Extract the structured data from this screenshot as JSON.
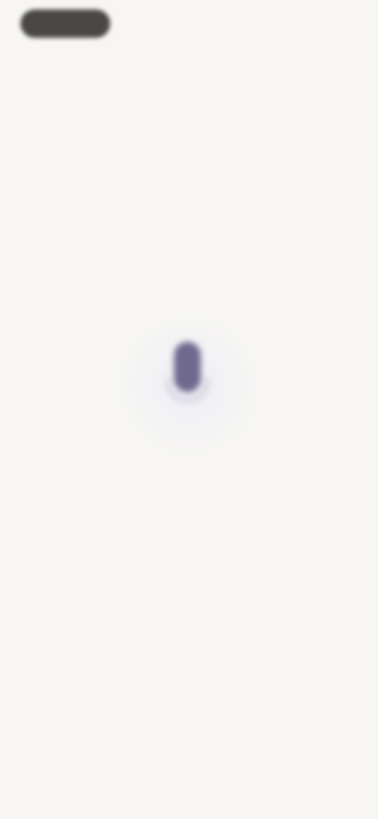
{
  "status_bar": {
    "time": "",
    "pill_color": "#4a4845"
  },
  "mic": {
    "icon": "microphone-icon",
    "color": "#6e6a8e"
  },
  "prompt": {
    "text": ""
  },
  "colors": {
    "background": "#f7f6f3",
    "muted_text": "#b6b4b1"
  }
}
